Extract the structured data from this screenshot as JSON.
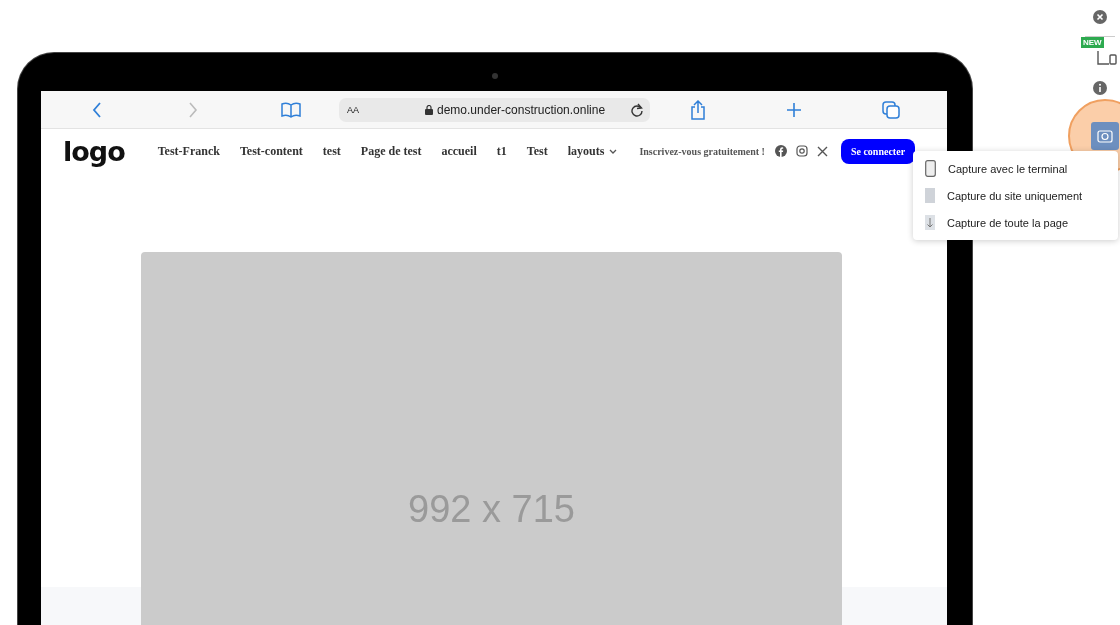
{
  "browser": {
    "text_size": "AA",
    "url": "demo.under-construction.online"
  },
  "site": {
    "logo": "logo",
    "nav": [
      {
        "label": "Test-Franck",
        "dropdown": false
      },
      {
        "label": "Test-content",
        "dropdown": false
      },
      {
        "label": "test",
        "dropdown": false
      },
      {
        "label": "Page de test",
        "dropdown": false
      },
      {
        "label": "accueil",
        "dropdown": false
      },
      {
        "label": "t1",
        "dropdown": false
      },
      {
        "label": "Test",
        "dropdown": false
      },
      {
        "label": "layouts",
        "dropdown": true
      }
    ],
    "signup": "Inscrivez-vous gratuitement !",
    "login": "Se connecter",
    "placeholder": "992 x 715"
  },
  "side_toolbar": {
    "new_badge": "NEW"
  },
  "capture_menu": [
    {
      "kind": "device",
      "label": "Capture avec le terminal"
    },
    {
      "kind": "site",
      "label": "Capture du site uniquement"
    },
    {
      "kind": "full",
      "label": "Capture de toute la page"
    }
  ]
}
